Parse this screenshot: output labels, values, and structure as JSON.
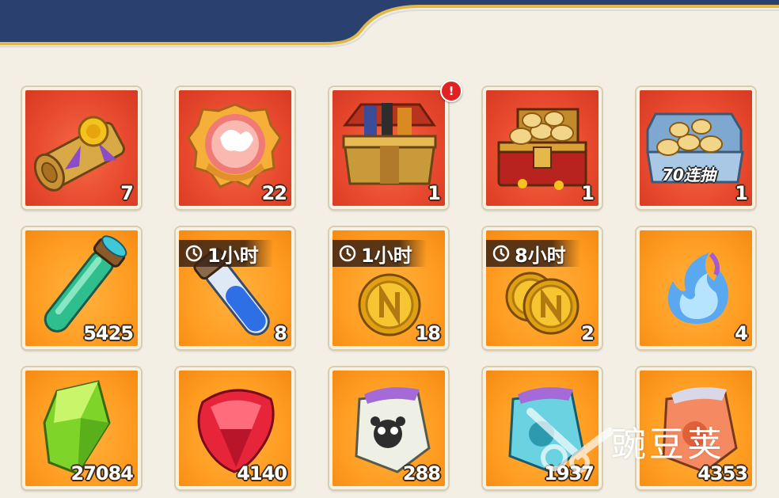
{
  "inventory": {
    "items": [
      {
        "name": "scroll",
        "count": "7",
        "bg": "red"
      },
      {
        "name": "badge",
        "count": "22",
        "bg": "red"
      },
      {
        "name": "gift-box",
        "count": "1",
        "bg": "red",
        "alert": "!"
      },
      {
        "name": "treasure-chest",
        "count": "1",
        "bg": "red"
      },
      {
        "name": "scroll-crate",
        "count": "1",
        "bg": "red",
        "tag": "70连抽"
      },
      {
        "name": "green-potion",
        "count": "5425",
        "bg": "orange"
      },
      {
        "name": "blue-potion",
        "count": "8",
        "bg": "orange",
        "timer": "1小时"
      },
      {
        "name": "gold-coin",
        "count": "18",
        "bg": "orange",
        "timer": "1小时"
      },
      {
        "name": "gold-coins",
        "count": "2",
        "bg": "orange",
        "timer": "8小时"
      },
      {
        "name": "blue-flame",
        "count": "4",
        "bg": "orange"
      },
      {
        "name": "green-gem",
        "count": "27084",
        "bg": "orange"
      },
      {
        "name": "red-gem",
        "count": "4140",
        "bg": "orange"
      },
      {
        "name": "panda-pouch",
        "count": "288",
        "bg": "orange"
      },
      {
        "name": "blue-pouch",
        "count": "1937",
        "bg": "orange"
      },
      {
        "name": "orange-pouch",
        "count": "4353",
        "bg": "orange"
      }
    ]
  },
  "watermark": {
    "text": "豌豆荚"
  },
  "colors": {
    "header": "#2a4170",
    "header_trim": "#e2b84a",
    "slot_red": "#e8492e",
    "slot_orange": "#ff9d22"
  }
}
